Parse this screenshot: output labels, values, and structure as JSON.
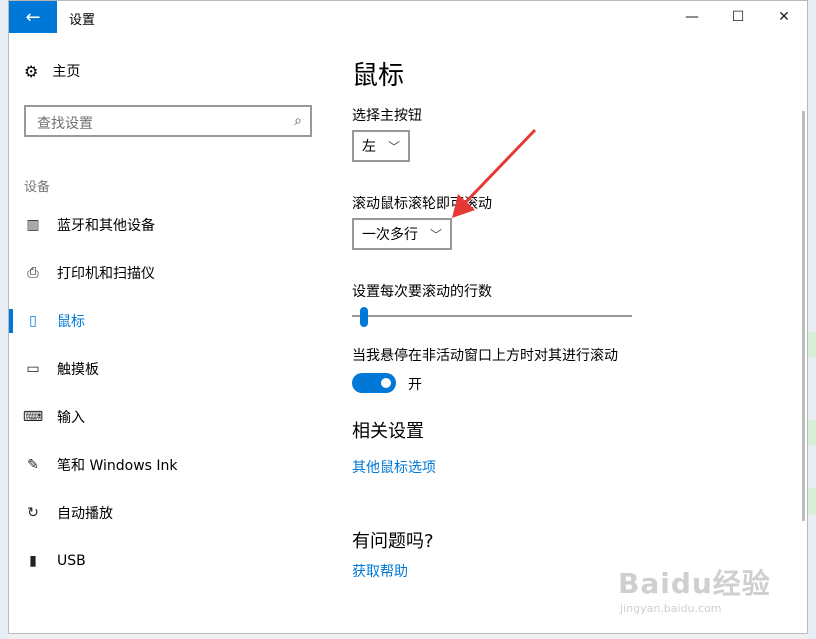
{
  "window": {
    "title": "设置"
  },
  "titlebar": {
    "back_icon": "←",
    "minimize_icon": "—",
    "maximize_icon": "☐",
    "close_icon": "✕"
  },
  "nav": {
    "home_label": "主页",
    "home_icon": "⚙",
    "search_placeholder": "查找设置",
    "search_icon": "⌕",
    "section_label": "设备",
    "items": [
      {
        "label": "蓝牙和其他设备",
        "icon": "▥"
      },
      {
        "label": "打印机和扫描仪",
        "icon": "⎙"
      },
      {
        "label": "鼠标",
        "icon": "▯"
      },
      {
        "label": "触摸板",
        "icon": "▭"
      },
      {
        "label": "输入",
        "icon": "⌨"
      },
      {
        "label": "笔和 Windows Ink",
        "icon": "✎"
      },
      {
        "label": "自动播放",
        "icon": "↻"
      },
      {
        "label": "USB",
        "icon": "▮"
      }
    ],
    "active_index": 2
  },
  "main": {
    "title": "鼠标",
    "primary_button_label": "选择主按钮",
    "primary_button_value": "左",
    "scroll_label": "滚动鼠标滚轮即可滚动",
    "scroll_value": "一次多行",
    "lines_label": "设置每次要滚动的行数",
    "lines_slider_fraction": 0.03,
    "inactive_scroll_label": "当我悬停在非活动窗口上方时对其进行滚动",
    "inactive_scroll_state": "开",
    "related_heading": "相关设置",
    "related_link": "其他鼠标选项",
    "help_heading": "有问题吗?",
    "help_link": "获取帮助"
  },
  "watermark": {
    "text": "Baidu经验",
    "sub": "jingyan.baidu.com"
  },
  "colors": {
    "accent": "#0078d7",
    "annotation_arrow": "#e53935"
  }
}
